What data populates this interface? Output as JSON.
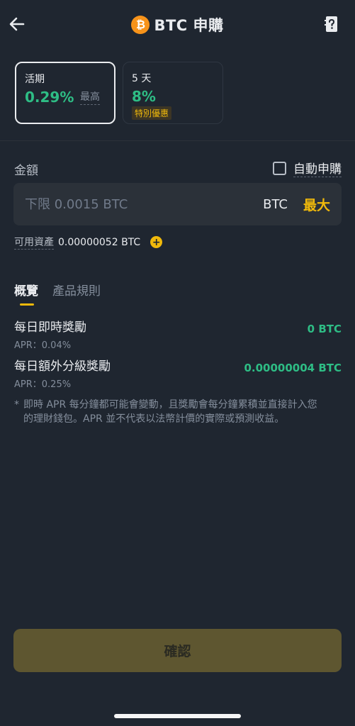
{
  "header": {
    "title": "BTC 申購",
    "coin_symbol": "₿",
    "coin_color": "#f7931a"
  },
  "products": [
    {
      "label": "活期",
      "rate": "0.29%",
      "note": "最高"
    },
    {
      "label": "5 天",
      "rate": "8%",
      "badge": "特別優惠"
    }
  ],
  "amount": {
    "label": "金額",
    "auto_subscribe_label": "自動申購",
    "auto_subscribe_checked": false,
    "placeholder": "下限 0.0015 BTC",
    "value": "",
    "unit": "BTC",
    "max_label": "最大"
  },
  "available": {
    "label": "可用資產",
    "value": "0.00000052 BTC"
  },
  "tabs": [
    {
      "label": "概覽",
      "active": true
    },
    {
      "label": "產品規則",
      "active": false
    }
  ],
  "rewards": [
    {
      "name": "每日即時獎勵",
      "apr": "APR：0.04%",
      "value": "0 BTC"
    },
    {
      "name": "每日額外分級獎勵",
      "apr": "APR：0.25%",
      "value": "0.00000004 BTC"
    }
  ],
  "footnote": {
    "mark": "*",
    "text": "即時 APR 每分鐘都可能會變動，且獎勵會每分鐘累積並直接計入您的理財錢包。APR 並不代表以法幣計價的實際或預測收益。"
  },
  "confirm_label": "確認",
  "colors": {
    "background": "#1f2630",
    "accent": "#f0b90b",
    "positive": "#2ebd85"
  }
}
